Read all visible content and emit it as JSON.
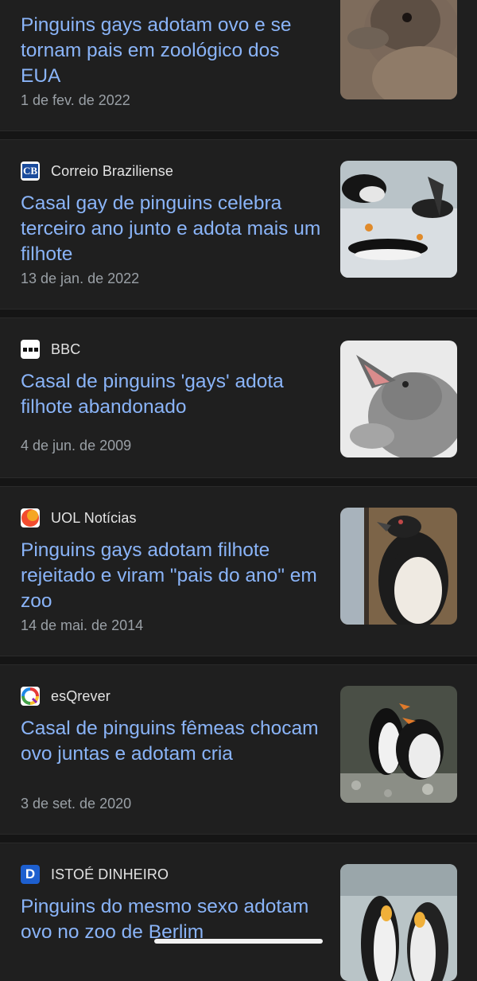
{
  "articles": [
    {
      "source": "",
      "headline": "Pinguins gays adotam ovo e se tornam pais em zoológico dos EUA",
      "date": "1 de fev. de 2022",
      "thumbnail_icon": "penguin-chick-photo"
    },
    {
      "source": "Correio Braziliense",
      "logo_text": "CB",
      "logo_color": "#1a4b9c",
      "headline": "Casal gay de pinguins celebra terceiro ano junto e adota mais um filhote",
      "date": "13 de jan. de 2022",
      "thumbnail_icon": "penguins-snow-photo"
    },
    {
      "source": "BBC",
      "logo_text": "•••",
      "logo_color": "#ffffff",
      "headline": "Casal de pinguins 'gays' adota filhote abandonado",
      "date": "4 de jun. de 2009",
      "thumbnail_icon": "penguin-chick-open-beak-photo"
    },
    {
      "source": "UOL Notícias",
      "logo_color": "#f5a623",
      "headline": "Pinguins gays adotam filhote rejeitado e viram \"pais do ano\" em zoo",
      "date": "14 de mai. de 2014",
      "thumbnail_icon": "humboldt-penguin-photo"
    },
    {
      "source": "esQrever",
      "logo_text": "Q",
      "headline": "Casal de pinguins fêmeas chocam ovo juntas e adotam cria",
      "date": "3 de set. de 2020",
      "thumbnail_icon": "two-penguins-rocks-photo"
    },
    {
      "source": "ISTOÉ DINHEIRO",
      "logo_text": "D",
      "logo_color": "#1d5fcf",
      "headline": "Pinguins do mesmo sexo adotam ovo no zoo de Berlim",
      "date": "",
      "thumbnail_icon": "king-penguins-photo"
    }
  ],
  "colors": {
    "background": "#1f1f1f",
    "headline": "#8ab4f8",
    "meta": "#9aa0a6",
    "source": "#e3e3e3"
  }
}
